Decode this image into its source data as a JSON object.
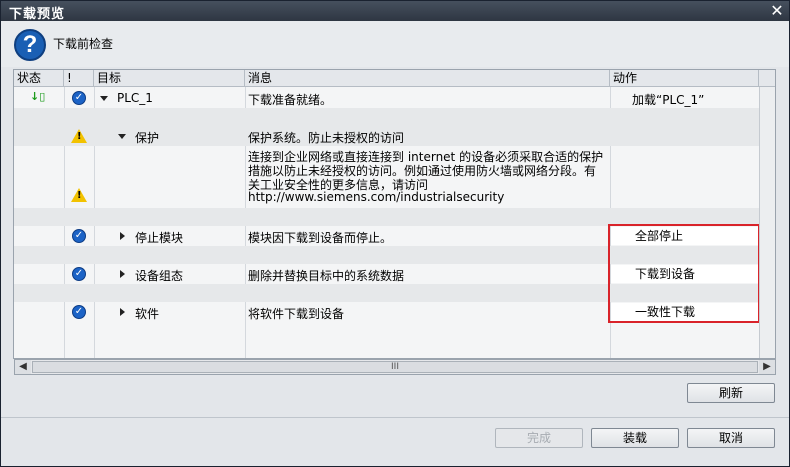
{
  "window": {
    "title": "下载预览",
    "close_icon": "close-icon"
  },
  "header": {
    "heading": "下载前检查",
    "icon": "help-icon"
  },
  "columns": {
    "status": "状态",
    "bang": "!",
    "target": "目标",
    "message": "消息",
    "action": "动作"
  },
  "rows": [
    {
      "target": "PLC_1",
      "message": "下载准备就绪。",
      "action": "加载“PLC_1”"
    },
    {
      "target": "保护",
      "message": "保护系统。防止未授权的访问"
    },
    {
      "message_lines": [
        "连接到企业网络或直接连接到 internet 的设备必须采取合适的保护",
        "措施以防止未经授权的访问。例如通过使用防火墙或网络分段。有",
        "关工业安全性的更多信息，请访问",
        "http://www.siemens.com/industrialsecurity"
      ]
    },
    {
      "target": "停止模块",
      "message": "模块因下载到设备而停止。",
      "action": "全部停止"
    },
    {
      "target": "设备组态",
      "message": "删除并替换目标中的系统数据",
      "action": "下载到设备"
    },
    {
      "target": "软件",
      "message": "将软件下载到设备",
      "action": "一致性下载"
    }
  ],
  "scrollbar": {
    "thumb_label": "III"
  },
  "buttons": {
    "refresh": "刷新",
    "finish": "完成",
    "load": "装载",
    "cancel": "取消"
  },
  "colors": {
    "titlebar": "#2e3642",
    "highlight": "#d9232a",
    "check": "#1c63c6",
    "warning": "#f2c200"
  }
}
